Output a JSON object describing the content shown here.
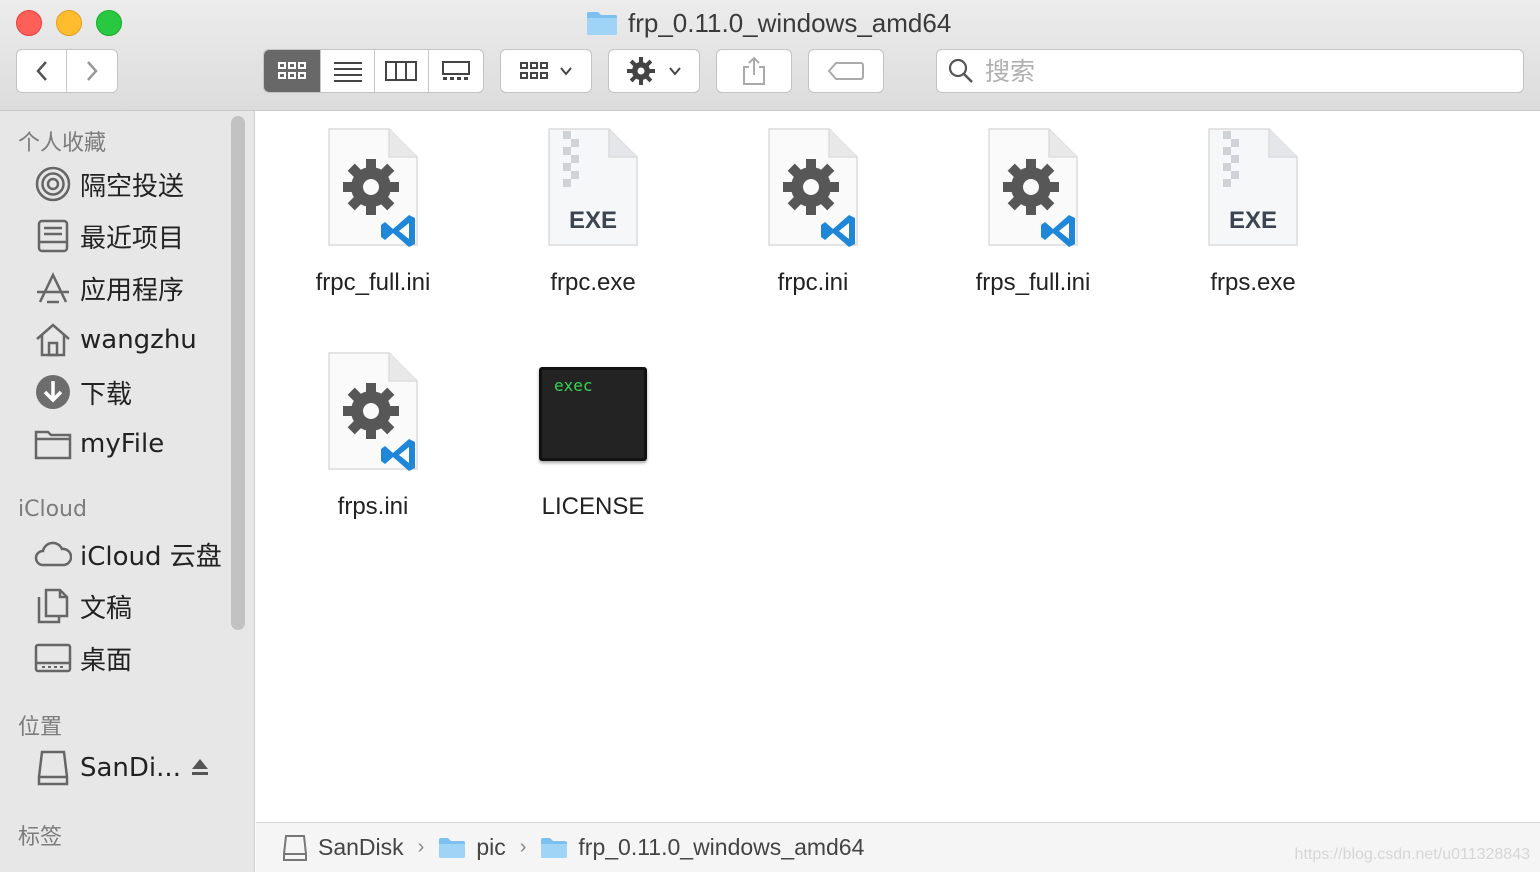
{
  "window": {
    "title": "frp_0.11.0_windows_amd64"
  },
  "toolbar": {
    "search_placeholder": "搜索"
  },
  "sidebar": {
    "favorites_header": "个人收藏",
    "favorites": [
      {
        "label": "隔空投送",
        "icon": "airdrop-icon"
      },
      {
        "label": "最近项目",
        "icon": "recents-icon"
      },
      {
        "label": "应用程序",
        "icon": "applications-icon"
      },
      {
        "label": "wangzhu",
        "icon": "home-icon"
      },
      {
        "label": "下载",
        "icon": "downloads-icon"
      },
      {
        "label": "myFile",
        "icon": "folder-icon"
      }
    ],
    "icloud_header": "iCloud",
    "icloud": [
      {
        "label": "iCloud 云盘",
        "icon": "cloud-icon"
      },
      {
        "label": "文稿",
        "icon": "documents-icon"
      },
      {
        "label": "桌面",
        "icon": "desktop-icon"
      }
    ],
    "locations_header": "位置",
    "locations": [
      {
        "label": "SanDi...",
        "icon": "drive-icon"
      }
    ],
    "tags_header": "标签"
  },
  "files": [
    {
      "name": "frpc_full.ini",
      "kind": "ini"
    },
    {
      "name": "frpc.exe",
      "kind": "exe",
      "badge": "EXE"
    },
    {
      "name": "frpc.ini",
      "kind": "ini"
    },
    {
      "name": "frps_full.ini",
      "kind": "ini"
    },
    {
      "name": "frps.exe",
      "kind": "exe",
      "badge": "EXE"
    },
    {
      "name": "frps.ini",
      "kind": "ini"
    },
    {
      "name": "LICENSE",
      "kind": "exec",
      "badge": "exec"
    }
  ],
  "pathbar": {
    "items": [
      "SanDisk",
      "pic",
      "frp_0.11.0_windows_amd64"
    ]
  },
  "watermark": "https://blog.csdn.net/u011328843"
}
